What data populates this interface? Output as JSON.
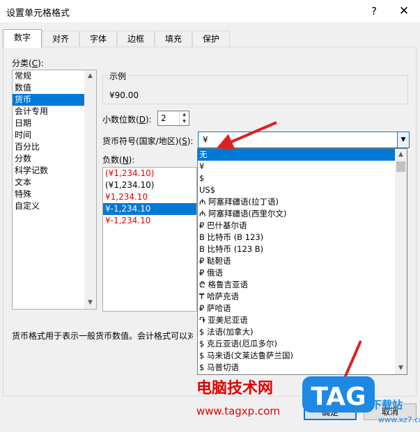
{
  "window": {
    "title": "设置单元格格式",
    "help": "?",
    "close": "✕"
  },
  "tabs": [
    {
      "label": "数字",
      "active": true
    },
    {
      "label": "对齐",
      "active": false
    },
    {
      "label": "字体",
      "active": false
    },
    {
      "label": "边框",
      "active": false
    },
    {
      "label": "填充",
      "active": false
    },
    {
      "label": "保护",
      "active": false
    }
  ],
  "category": {
    "label": "分类(",
    "key": "C",
    "label_end": "):",
    "items": [
      "常规",
      "数值",
      "货币",
      "会计专用",
      "日期",
      "时间",
      "百分比",
      "分数",
      "科学记数",
      "文本",
      "特殊",
      "自定义"
    ],
    "selected": "货币"
  },
  "sample": {
    "label": "示例",
    "value": "¥90.00"
  },
  "decimals": {
    "label": "小数位数(",
    "key": "D",
    "label_end": "):",
    "value": "2"
  },
  "currency": {
    "label": "货币符号(国家/地区)(",
    "key": "S",
    "label_end": "):",
    "value": "¥"
  },
  "negative": {
    "label": "负数(",
    "key": "N",
    "label_end": "):",
    "items": [
      {
        "text": "(¥1,234.10)",
        "red": true
      },
      {
        "text": "(¥1,234.10)",
        "red": false
      },
      {
        "text": "¥1,234.10",
        "red": true
      },
      {
        "text": "¥-1,234.10",
        "red": false
      },
      {
        "text": "¥-1,234.10",
        "red": true
      }
    ],
    "selected_index": 3
  },
  "description": "货币格式用于表示一般货币数值。会计格式可以对一列数值进行小数点对齐。",
  "dropdown": {
    "items": [
      "无",
      "¥",
      "$",
      "US$",
      "₼ 阿塞拜疆语(拉丁语)",
      "₼ 阿塞拜疆语(西里尔文)",
      "₽ 巴什基尔语",
      "B 比特币 (B 123)",
      "B 比特币 (123 B)",
      "₽ 鞑靼语",
      "₽ 俄语",
      "₾ 格鲁吉亚语",
      "₸ 哈萨克语",
      "₽ 萨哈语",
      "֏ 亚美尼亚语",
      "$ 法语(加拿大)",
      "$ 克丘亚语(厄瓜多尔)",
      "$ 马来语(文莱达鲁萨兰国)",
      "$ 马普切语"
    ],
    "selected_index": 0
  },
  "buttons": {
    "ok": "确定",
    "cancel": "取消"
  },
  "watermark": {
    "text": "电脑技术网",
    "url": "www.tagxp.com",
    "logo": "TAG",
    "site": "下载站",
    "site_url": "www.xz7.com"
  },
  "colors": {
    "accent": "#0078d7",
    "negative_red": "#e00000",
    "annotation_arrow": "#e02020"
  }
}
